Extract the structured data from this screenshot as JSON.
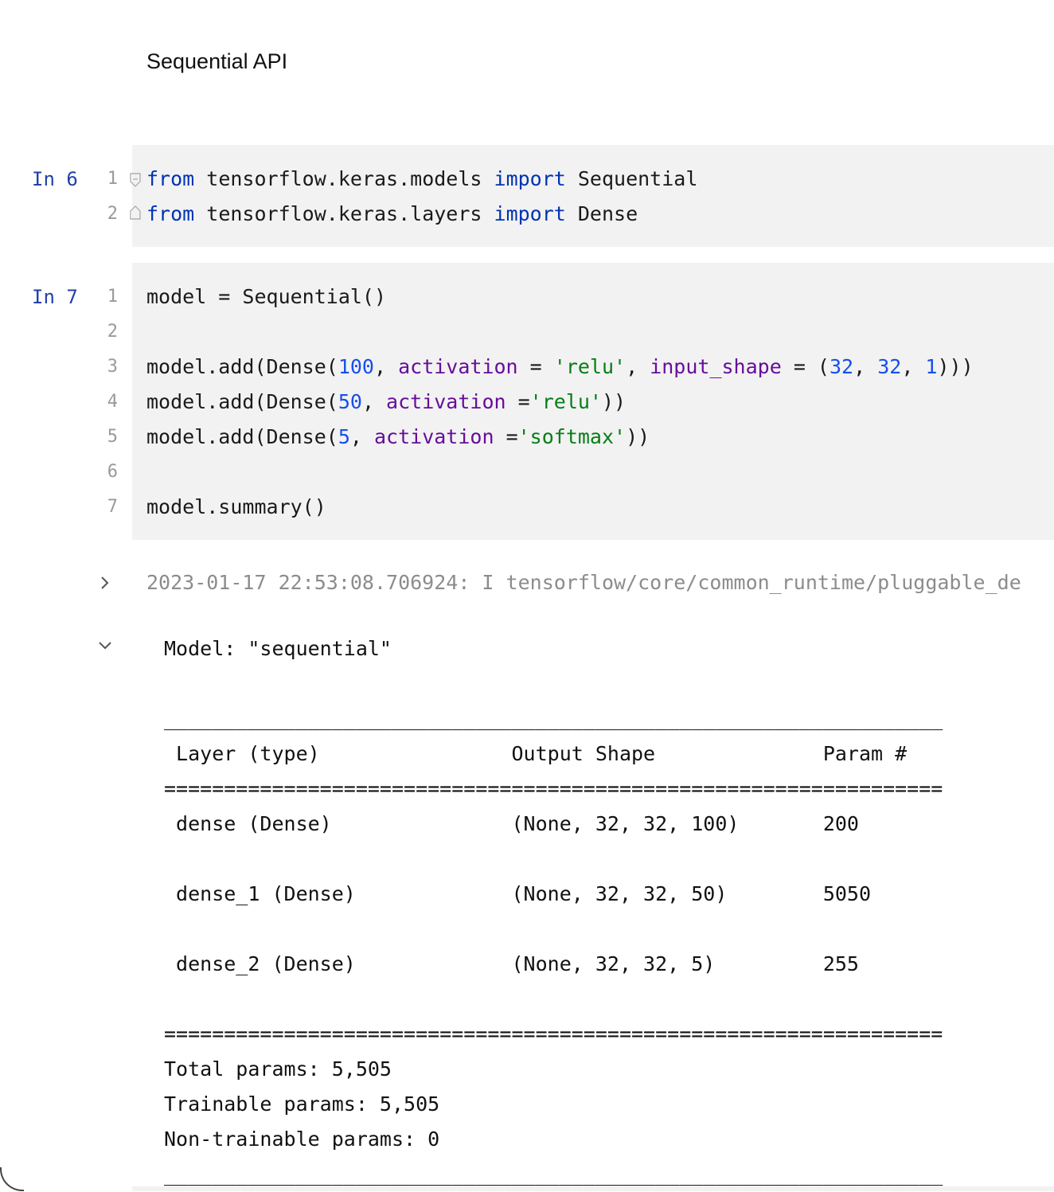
{
  "markdown": {
    "heading": "Sequential API"
  },
  "cell6": {
    "label": "In 6",
    "line_numbers": [
      "1",
      "2"
    ],
    "lines": [
      [
        {
          "t": "from",
          "c": "kw"
        },
        {
          "t": " tensorflow.keras.models ",
          "c": ""
        },
        {
          "t": "import",
          "c": "kw"
        },
        {
          "t": " Sequential",
          "c": ""
        }
      ],
      [
        {
          "t": "from",
          "c": "kw"
        },
        {
          "t": " tensorflow.keras.layers ",
          "c": ""
        },
        {
          "t": "import",
          "c": "kw"
        },
        {
          "t": " Dense",
          "c": ""
        }
      ]
    ]
  },
  "cell7": {
    "label": "In 7",
    "line_numbers": [
      "1",
      "2",
      "3",
      "4",
      "5",
      "6",
      "7"
    ],
    "lines": [
      [
        {
          "t": "model = Sequential()",
          "c": ""
        }
      ],
      [],
      [
        {
          "t": "model.add(Dense(",
          "c": ""
        },
        {
          "t": "100",
          "c": "num"
        },
        {
          "t": ", ",
          "c": ""
        },
        {
          "t": "activation",
          "c": "kwarg"
        },
        {
          "t": " = ",
          "c": ""
        },
        {
          "t": "'relu'",
          "c": "str"
        },
        {
          "t": ", ",
          "c": ""
        },
        {
          "t": "input_shape",
          "c": "kwarg"
        },
        {
          "t": " = (",
          "c": ""
        },
        {
          "t": "32",
          "c": "num"
        },
        {
          "t": ", ",
          "c": ""
        },
        {
          "t": "32",
          "c": "num"
        },
        {
          "t": ", ",
          "c": ""
        },
        {
          "t": "1",
          "c": "num"
        },
        {
          "t": ")))",
          "c": ""
        }
      ],
      [
        {
          "t": "model.add(Dense(",
          "c": ""
        },
        {
          "t": "50",
          "c": "num"
        },
        {
          "t": ", ",
          "c": ""
        },
        {
          "t": "activation",
          "c": "kwarg"
        },
        {
          "t": " =",
          "c": ""
        },
        {
          "t": "'relu'",
          "c": "str"
        },
        {
          "t": "))",
          "c": ""
        }
      ],
      [
        {
          "t": "model.add(Dense(",
          "c": ""
        },
        {
          "t": "5",
          "c": "num"
        },
        {
          "t": ", ",
          "c": ""
        },
        {
          "t": "activation",
          "c": "kwarg"
        },
        {
          "t": " =",
          "c": ""
        },
        {
          "t": "'softmax'",
          "c": "str"
        },
        {
          "t": "))",
          "c": ""
        }
      ],
      [],
      [
        {
          "t": "model.summary()",
          "c": ""
        }
      ]
    ]
  },
  "output": {
    "log_line": "2023-01-17 22:53:08.706924: I tensorflow/core/common_runtime/pluggable_de",
    "summary_lines": [
      "Model: \"sequential\"",
      "",
      "_________________________________________________________________",
      " Layer (type)                Output Shape              Param #   ",
      "=================================================================",
      " dense (Dense)               (None, 32, 32, 100)       200       ",
      "",
      " dense_1 (Dense)             (None, 32, 32, 50)        5050      ",
      "",
      " dense_2 (Dense)             (None, 32, 32, 5)         255       ",
      "",
      "=================================================================",
      "Total params: 5,505",
      "Trainable params: 5,505",
      "Non-trainable params: 0",
      "_________________________________________________________________"
    ]
  },
  "icons": {
    "fold_start": "fold-start-icon",
    "fold_end": "fold-end-icon",
    "collapsed_output": "chevron-right-icon",
    "expanded_output": "chevron-down-icon"
  }
}
